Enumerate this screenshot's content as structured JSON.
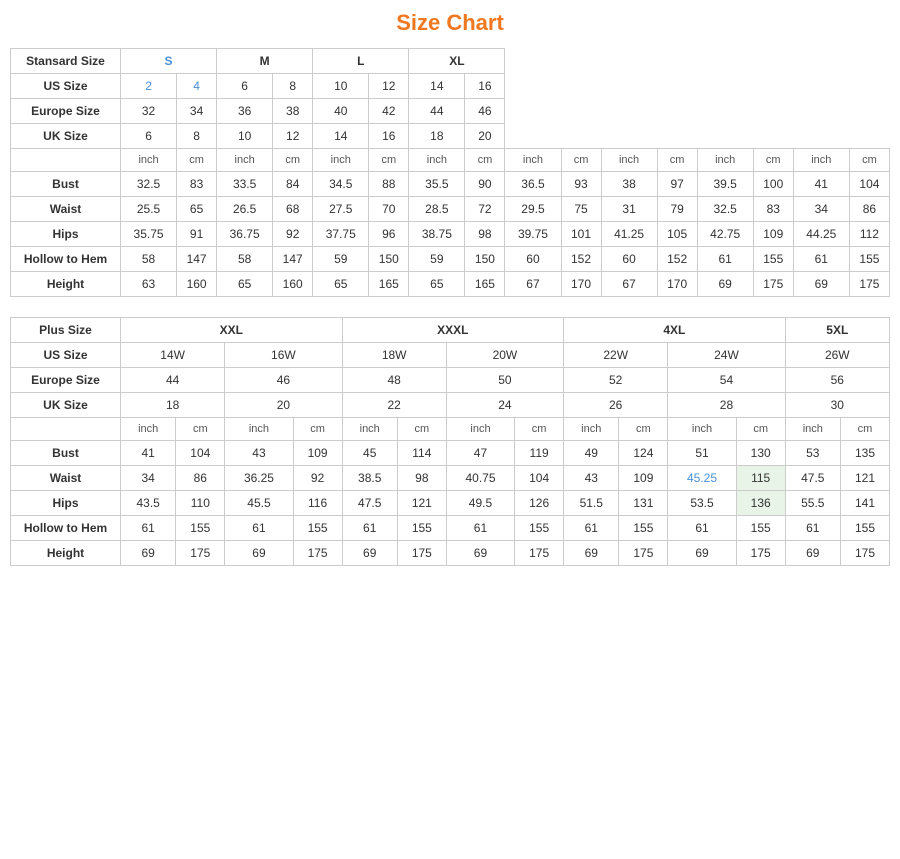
{
  "title": "Size Chart",
  "standard": {
    "table1": {
      "headers": [
        "Stansard Size",
        "S",
        "",
        "M",
        "",
        "L",
        "",
        "XL",
        ""
      ],
      "sizeRow": [
        "US Size",
        "2",
        "4",
        "6",
        "8",
        "10",
        "12",
        "14",
        "16"
      ],
      "europeRow": [
        "Europe Size",
        "32",
        "34",
        "36",
        "38",
        "40",
        "42",
        "44",
        "46"
      ],
      "ukRow": [
        "UK Size",
        "6",
        "8",
        "10",
        "12",
        "14",
        "16",
        "18",
        "20"
      ],
      "unitRow": [
        "",
        "inch",
        "cm",
        "inch",
        "cm",
        "inch",
        "cm",
        "inch",
        "cm",
        "inch",
        "cm",
        "inch",
        "cm",
        "inch",
        "cm",
        "inch",
        "cm"
      ],
      "bust": [
        "Bust",
        "32.5",
        "83",
        "33.5",
        "84",
        "34.5",
        "88",
        "35.5",
        "90",
        "36.5",
        "93",
        "38",
        "97",
        "39.5",
        "100",
        "41",
        "104"
      ],
      "waist": [
        "Waist",
        "25.5",
        "65",
        "26.5",
        "68",
        "27.5",
        "70",
        "28.5",
        "72",
        "29.5",
        "75",
        "31",
        "79",
        "32.5",
        "83",
        "34",
        "86"
      ],
      "hips": [
        "Hips",
        "35.75",
        "91",
        "36.75",
        "92",
        "37.75",
        "96",
        "38.75",
        "98",
        "39.75",
        "101",
        "41.25",
        "105",
        "42.75",
        "109",
        "44.25",
        "112"
      ],
      "hollow": [
        "Hollow to Hem",
        "58",
        "147",
        "58",
        "147",
        "59",
        "150",
        "59",
        "150",
        "60",
        "152",
        "60",
        "152",
        "61",
        "155",
        "61",
        "155"
      ],
      "height": [
        "Height",
        "63",
        "160",
        "65",
        "160",
        "65",
        "165",
        "65",
        "165",
        "67",
        "170",
        "67",
        "170",
        "69",
        "175",
        "69",
        "175"
      ]
    }
  },
  "plus": {
    "table2": {
      "plusLabel": "Plus Size",
      "xxlLabel": "XXL",
      "xxxlLabel": "XXXL",
      "fourxlLabel": "4XL",
      "fivexlLabel": "5XL",
      "sizeRow": [
        "US Size",
        "14W",
        "16W",
        "18W",
        "20W",
        "22W",
        "24W",
        "26W"
      ],
      "europeRow": [
        "Europe Size",
        "44",
        "46",
        "48",
        "50",
        "52",
        "54",
        "56"
      ],
      "ukRow": [
        "UK Size",
        "18",
        "20",
        "22",
        "24",
        "26",
        "28",
        "30"
      ],
      "unitRow": [
        "",
        "inch",
        "cm",
        "inch",
        "cm",
        "inch",
        "cm",
        "inch",
        "cm",
        "inch",
        "cm",
        "inch",
        "cm",
        "inch",
        "cm"
      ],
      "bust": [
        "Bust",
        "41",
        "104",
        "43",
        "109",
        "45",
        "114",
        "47",
        "119",
        "49",
        "124",
        "51",
        "130",
        "53",
        "135"
      ],
      "waist": [
        "Waist",
        "34",
        "86",
        "36.25",
        "92",
        "38.5",
        "98",
        "40.75",
        "104",
        "43",
        "109",
        "45.25",
        "115",
        "47.5",
        "121"
      ],
      "hips": [
        "Hips",
        "43.5",
        "110",
        "45.5",
        "116",
        "47.5",
        "121",
        "49.5",
        "126",
        "51.5",
        "131",
        "53.5",
        "136",
        "55.5",
        "141"
      ],
      "hollow": [
        "Hollow to Hem",
        "61",
        "155",
        "61",
        "155",
        "61",
        "155",
        "61",
        "155",
        "61",
        "155",
        "61",
        "155",
        "61",
        "155"
      ],
      "height": [
        "Height",
        "69",
        "175",
        "69",
        "175",
        "69",
        "175",
        "69",
        "175",
        "69",
        "175",
        "69",
        "175",
        "69",
        "175"
      ]
    }
  }
}
